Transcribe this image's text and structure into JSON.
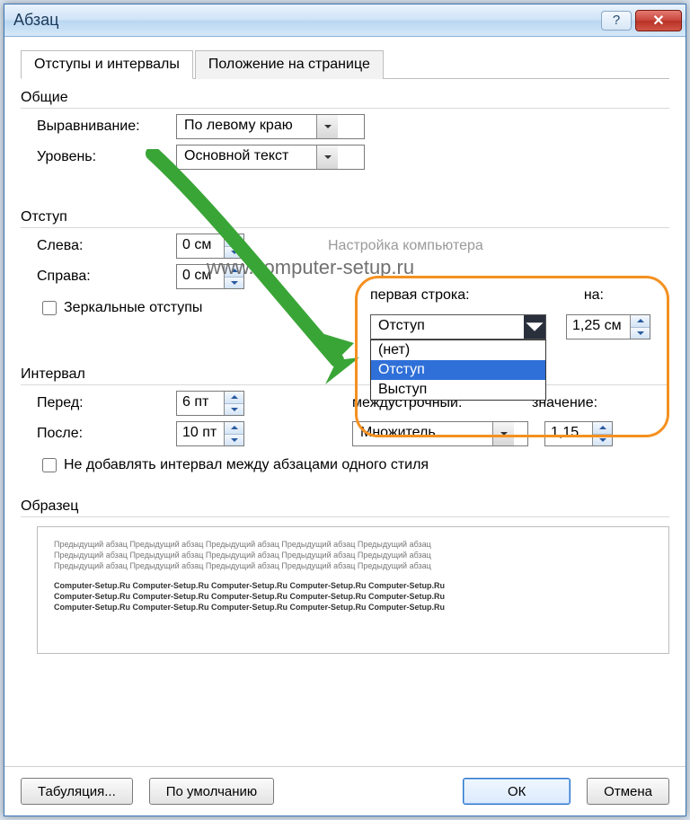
{
  "titlebar": {
    "title": "Абзац"
  },
  "tabs": [
    {
      "label": "Отступы и интервалы",
      "active": true
    },
    {
      "label": "Положение на странице",
      "active": false
    }
  ],
  "groups": {
    "general": {
      "title": "Общие",
      "alignment_label": "Выравнивание:",
      "alignment_value": "По левому краю",
      "level_label": "Уровень:",
      "level_value": "Основной текст"
    },
    "indent": {
      "title": "Отступ",
      "left_label": "Слева:",
      "left_value": "0 см",
      "right_label": "Справа:",
      "right_value": "0 см",
      "mirror_label": "Зеркальные отступы",
      "mirror_checked": false
    },
    "first_line": {
      "label": "первая строка:",
      "by_label": "на:",
      "selected": "Отступ",
      "options": [
        "(нет)",
        "Отступ",
        "Выступ"
      ],
      "by_value": "1,25 см"
    },
    "interval": {
      "title": "Интервал",
      "before_label": "Перед:",
      "before_value": "6 пт",
      "after_label": "После:",
      "after_value": "10 пт",
      "line_label": "междустрочный:",
      "line_value": "Множитель",
      "at_label": "значение:",
      "at_value": "1,15",
      "nodup_label": "Не добавлять интервал между абзацами одного стиля",
      "nodup_checked": false
    },
    "sample": {
      "title": "Образец",
      "prev_line": "Предыдущий абзац Предыдущий абзац Предыдущий абзац Предыдущий абзац Предыдущий абзац",
      "body_line": "Computer-Setup.Ru Computer-Setup.Ru Computer-Setup.Ru Computer-Setup.Ru Computer-Setup.Ru"
    }
  },
  "watermark": {
    "line1": "Настройка компьютера",
    "line2": "www.computer-setup.ru"
  },
  "footer": {
    "tabs": "Табуляция...",
    "default": "По умолчанию",
    "ok": "ОК",
    "cancel": "Отмена"
  }
}
